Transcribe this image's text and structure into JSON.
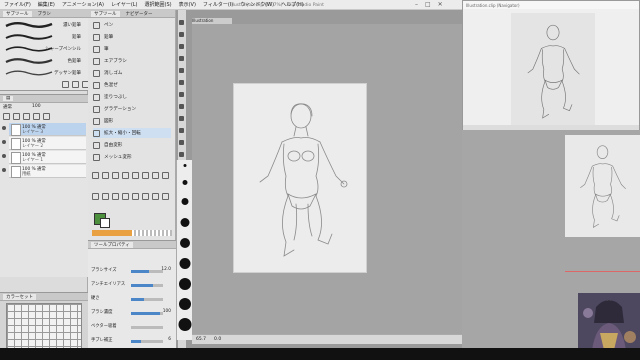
{
  "menu": {
    "items": [
      "ファイル(F)",
      "編集(E)",
      "アニメーション(A)",
      "レイヤー(L)",
      "選択範囲(S)",
      "表示(V)",
      "フィルター(I)",
      "ウィンドウ(W)",
      "ヘルプ(H)"
    ]
  },
  "window": {
    "title": "Illustration.clip (65.7%) - Clip Studio Paint",
    "subwindow_title": "Illustration.clip (Navigator)"
  },
  "doc_tab": "Illustration",
  "brush_panel": {
    "tabs": [
      "サブツール",
      "ブラシ"
    ],
    "brushes": [
      "濃い鉛筆",
      "鉛筆",
      "シャープペンシル",
      "色鉛筆",
      "デッサン鉛筆"
    ]
  },
  "layer_panel": {
    "blend_mode": "通常",
    "opacity": "100",
    "layers": [
      {
        "name": "100 % 通常",
        "sub": "レイヤー 3"
      },
      {
        "name": "100 % 通常",
        "sub": "レイヤー 2"
      },
      {
        "name": "100 % 通常",
        "sub": "レイヤー 1"
      },
      {
        "name": "100 % 通常",
        "sub": "用紙"
      }
    ]
  },
  "tool_panel": {
    "tabs": [
      "サブツール",
      "ナビゲーター"
    ],
    "items": [
      "ペン",
      "鉛筆",
      "筆",
      "エアブラシ",
      "消しゴム",
      "色混ぜ",
      "塗りつぶし",
      "グラデーション",
      "図形",
      "拡大・縮小・回転",
      "自由変形",
      "メッシュ変形"
    ]
  },
  "tool_property": {
    "header": "ツールプロパティ",
    "rows": [
      {
        "label": "ブラシサイズ",
        "value": "12.0",
        "level": 0.55
      },
      {
        "label": "アンチエイリアス",
        "value": "",
        "level": 0.7
      },
      {
        "label": "硬さ",
        "value": "",
        "level": 0.4
      },
      {
        "label": "ブラシ濃度",
        "value": "100",
        "level": 0.9
      },
      {
        "label": "ベクター吸着",
        "value": "",
        "level": 0.0
      },
      {
        "label": "手ブレ補正",
        "value": "6",
        "level": 0.3
      }
    ]
  },
  "color_panel": {
    "tab": "カラーセット"
  },
  "statusbar": {
    "zoom": "65.7",
    "angle": "0.0"
  },
  "colors": {
    "accent": "#4a86c8",
    "orange": "#e8a040",
    "canvas_bg": "#a4a4a4",
    "paper": "#ececec"
  }
}
